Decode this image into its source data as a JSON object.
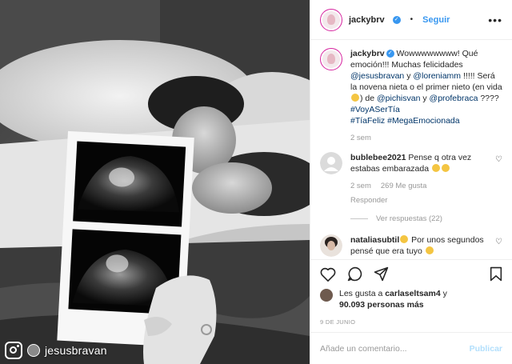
{
  "photo": {
    "repost_username": "jesusbravan"
  },
  "header": {
    "username": "jackybrv",
    "follow_label": "Seguir",
    "more_label": "•••"
  },
  "caption": {
    "username": "jackybrv",
    "text_1": "Wowwwwwwww! Qué emoción!!! Muchas felicidades ",
    "mention_1": "@jesusbravan",
    "text_2": " y ",
    "mention_2": "@loreniamm",
    "text_3": " !!!!! Será la novena nieta o el primer nieto (en vida ",
    "text_4": ") de ",
    "mention_3": "@pichisvan",
    "text_5": " y ",
    "mention_4": "@profebraca",
    "text_6": " ???? ",
    "hashtag_1": "#VoyASerTía",
    "hashtag_2": "#TíaFeliz",
    "hashtag_3": "#MegaEmocionada",
    "time": "2 sem"
  },
  "comments": [
    {
      "username": "bublebee2021",
      "text": " Pense q otra vez estabas embarazada ",
      "time": "2 sem",
      "likes": "269 Me gusta",
      "reply_label": "Responder",
      "view_replies": "Ver respuestas (22)"
    },
    {
      "username": "nataliasubtil",
      "text": " Por unos segundos pensé que era tuyo "
    }
  ],
  "likes": {
    "prefix": "Les gusta a ",
    "user": "carlaseltsam4",
    "connector": " y",
    "count": "90.093 personas más"
  },
  "post_date": "9 DE JUNIO",
  "add_comment": {
    "placeholder": "Añade un comentario...",
    "publish_label": "Publicar"
  },
  "colors": {
    "accent": "#3897f0",
    "mention": "#003569",
    "muted": "#999999"
  }
}
